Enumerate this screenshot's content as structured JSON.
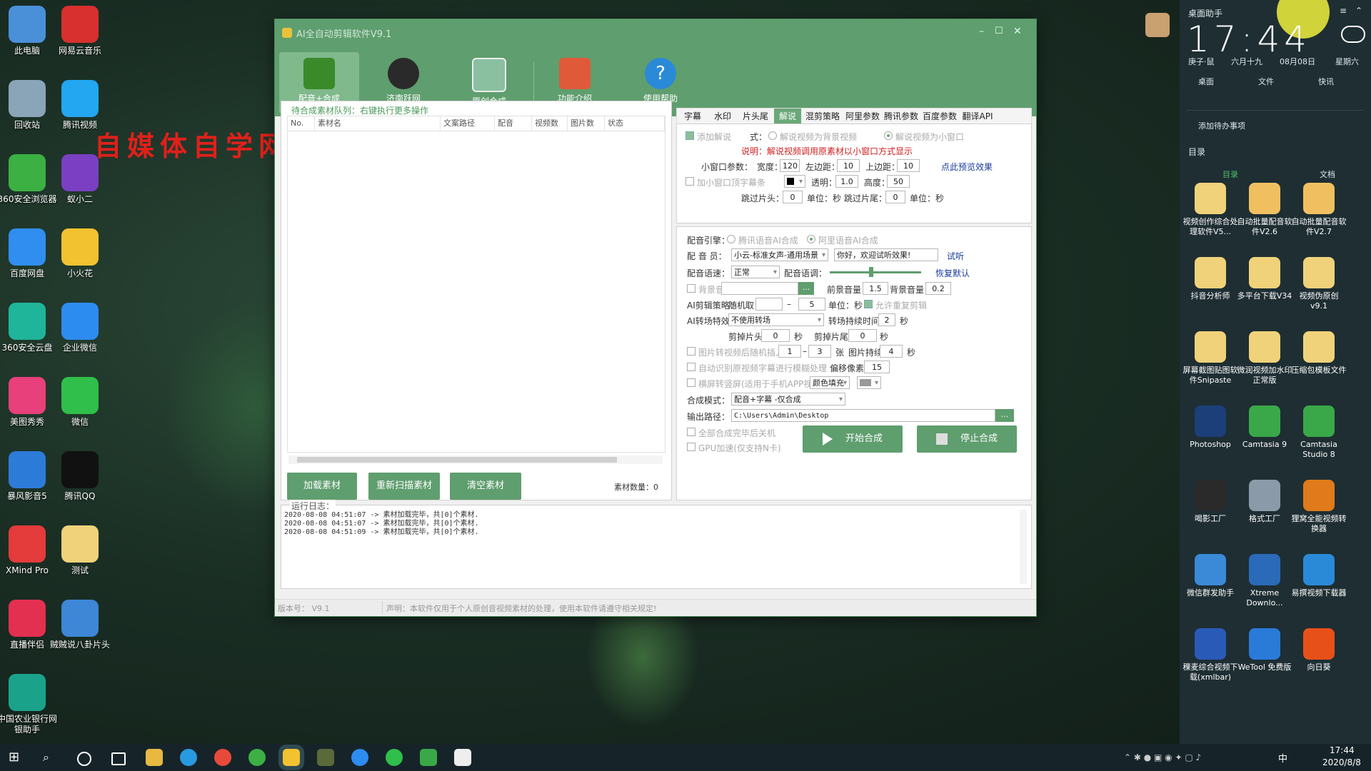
{
  "desktop": {
    "watermark": "自媒体自学网",
    "icons_left": [
      {
        "label": "此电脑",
        "color": "#4a90d9"
      },
      {
        "label": "回收站",
        "color": "#8aa4b8"
      },
      {
        "label": "360安全浏览器",
        "color": "#3cb043"
      },
      {
        "label": "百度网盘",
        "color": "#2f8ef0"
      },
      {
        "label": "360安全云盘",
        "color": "#1fb59a"
      },
      {
        "label": "美图秀秀",
        "color": "#e8407a"
      },
      {
        "label": "暴风影音5",
        "color": "#2d7bd8"
      },
      {
        "label": "XMind Pro",
        "color": "#e43b3b"
      },
      {
        "label": "直播伴侣",
        "color": "#e33050"
      },
      {
        "label": "中国农业银行网银助手",
        "color": "#1aa38a"
      }
    ],
    "icons_right": [
      {
        "label": "网易云音乐",
        "color": "#d8302e"
      },
      {
        "label": "腾讯视频",
        "color": "#22a7f0"
      },
      {
        "label": "蚁小二",
        "color": "#7a3fc2"
      },
      {
        "label": "小火花",
        "color": "#f2c230"
      },
      {
        "label": "企业微信",
        "color": "#2d8cf0"
      },
      {
        "label": "微信",
        "color": "#2fbf4a"
      },
      {
        "label": "腾讯QQ",
        "color": "#111111"
      },
      {
        "label": "测试",
        "color": "#f0d27a"
      },
      {
        "label": "贼贼说八卦片头",
        "color": "#3d87d6"
      }
    ]
  },
  "window": {
    "title": "AI全自动剪辑软件V9.1",
    "controls": [
      "–",
      "☐",
      "✕"
    ],
    "toolbar": [
      {
        "label": "配音+合成",
        "icon": "clapper-icon",
        "active": true
      },
      {
        "label": "济南跃网",
        "icon": "film-reel-icon",
        "active": false
      },
      {
        "label": "原创合成",
        "icon": "image-edit-icon",
        "active": false
      },
      {
        "label": "功能介绍",
        "icon": "home-icon",
        "active": false
      },
      {
        "label": "使用帮助",
        "icon": "help-icon",
        "active": false
      }
    ],
    "queue": {
      "title": "待合成素材队列：右键执行更多操作",
      "columns": [
        "No.",
        "素材名",
        "文案路径",
        "配音",
        "视频数",
        "图片数",
        "状态"
      ],
      "buttons": [
        "加载素材",
        "重新扫描素材",
        "清空素材"
      ],
      "count_label": "素材数量：",
      "count": "0"
    },
    "tabs": [
      "字幕",
      "水印",
      "片头尾",
      "解说",
      "混剪策略",
      "阿里参数",
      "腾讯参数",
      "百度参数",
      "翻译API"
    ],
    "active_tab": "解说",
    "narration": {
      "add_label": "添加解说",
      "mode_label": "式：",
      "mode_bg": "解说视频为背景视频",
      "mode_small": "解说视频为小窗口",
      "note": "说明：解说视频调用原素材以小窗口方式显示",
      "small_params": "小窗口参数：",
      "width_label": "宽度：",
      "width": "120",
      "left_label": "左边距：",
      "left": "10",
      "top_label": "上边距：",
      "top": "10",
      "preview": "点此预览效果",
      "top_sub_label": "加小窗口顶字幕条",
      "alpha_label": "透明：",
      "alpha": "1.0",
      "height_label": "高度：",
      "height": "50",
      "skip_head_label": "跳过片头：",
      "skip_head": "0",
      "unit_sec": "单位：秒",
      "skip_tail_label": "跳过片尾：",
      "skip_tail": "0"
    },
    "voice": {
      "engine_label": "配音引擎：",
      "engine_tencent": "腾讯语音AI合成",
      "engine_ali": "阿里语音AI合成",
      "actor_label": "配 音 员：",
      "actor": "小云-标准女声-通用场景",
      "sample_text": "你好，欢迎试听效果!",
      "try": "试听",
      "speed_label": "配音语速：",
      "speed": "正常",
      "tone_label": "配音语调：",
      "tone_level": 0.45,
      "reset": "恢复默认",
      "bgm_label": "背景音",
      "browse": "...",
      "fg_vol_label": "前景音量：",
      "fg_vol": "1.5",
      "bg_vol_label": "背景音量：",
      "bg_vol": "0.2",
      "cut_label": "AI剪辑策略：",
      "random_label": "随机取：",
      "random_from": "",
      "dash": "–",
      "random_to": "5",
      "unit_sec": "单位：秒",
      "allow_repeat": "允许重复剪辑",
      "transition_label": "AI转场特效：",
      "transition": "不使用转场",
      "trans_dur_label": "转场持续时间：",
      "trans_dur": "2",
      "sec": "秒",
      "cut_head_label": "剪掉片头：",
      "cut_head": "0",
      "cut_tail_label": "剪掉片尾：",
      "cut_tail": "0",
      "img_insert": "图片转视频后随机插入",
      "img_from": "1",
      "img_to": "3",
      "zhang": "张",
      "img_dur_label": "图片持续：",
      "img_dur": "4",
      "blur_sub": "自动识别原视频字幕进行模糊处理",
      "offset_label": "偏移像素：",
      "offset": "15",
      "portrait": "横屏转竖屏(适用于手机APP视频)",
      "fill": "颜色填充",
      "compose_label": "合成模式：",
      "compose": "配音+字幕 -仅合成",
      "output_label": "输出路径：",
      "output": "C:\\Users\\Admin\\Desktop",
      "shutdown": "全部合成完毕后关机",
      "gpu": "GPU加速(仅支持N卡)",
      "start": "开始合成",
      "stop": "停止合成"
    },
    "log": {
      "title": "运行日志：",
      "lines": [
        "2020-08-08 04:51:07 -> 素材加载完毕，共[0]个素材.",
        "2020-08-08 04:51:07 -> 素材加载完毕，共[0]个素材.",
        "2020-08-08 04:51:09 -> 素材加载完毕，共[0]个素材."
      ]
    },
    "status": {
      "version": "版本号： V9.1",
      "notice": "声明：本软件仅用于个人原创音视频素材的处理，使用本软件请遵守相关规定!"
    }
  },
  "side_panel": {
    "title": "桌面助手",
    "time": "17:44",
    "lunar1": "庚子·鼠",
    "lunar2": "六月十九",
    "date": "08月08日",
    "weekday": "星期六",
    "tabs": [
      "桌面",
      "文件",
      "快讯"
    ],
    "todo": "添加待办事项",
    "dir_label": "目录",
    "col1": "目录",
    "col2": "文档",
    "apps": [
      {
        "label": "视频创作综合处理软件V5...",
        "color": "#f0d27a"
      },
      {
        "label": "自动批量配音软件V2.6",
        "color": "#f0c060"
      },
      {
        "label": "自动批量配音软件V2.7",
        "color": "#f0c060"
      },
      {
        "label": "抖音分析师",
        "color": "#f0d27a"
      },
      {
        "label": "多平台下载V34",
        "color": "#f0d27a"
      },
      {
        "label": "视频伪原创v9.1",
        "color": "#f0d27a"
      },
      {
        "label": "屏幕截图贴图软件Snipaste",
        "color": "#f0d27a"
      },
      {
        "label": "微润视频加水印正常版",
        "color": "#f0d27a"
      },
      {
        "label": "压缩包模板文件",
        "color": "#f0d27a"
      },
      {
        "label": "Photoshop",
        "color": "#1c3f7a"
      },
      {
        "label": "Camtasia 9",
        "color": "#3aa848"
      },
      {
        "label": "Camtasia Studio 8",
        "color": "#3aa848"
      },
      {
        "label": "喝影工厂",
        "color": "#2a2a2a"
      },
      {
        "label": "格式工厂",
        "color": "#8a9aa8"
      },
      {
        "label": "狸窝全能视频转换器",
        "color": "#e07a1a"
      },
      {
        "label": "微信群发助手",
        "color": "#3a8ad8"
      },
      {
        "label": "Xtreme Downlo...",
        "color": "#2a6ab8"
      },
      {
        "label": "易撰视频下载器",
        "color": "#2a8ad8"
      },
      {
        "label": "稞麦综合视频下载(xmlbar)",
        "color": "#2a5ab8"
      },
      {
        "label": "WeTool 免费版",
        "color": "#2a7ad8"
      },
      {
        "label": "向日葵",
        "color": "#e8501a"
      }
    ]
  },
  "taskbar": {
    "time": "17:44",
    "date": "2020/8/8",
    "ime": "中"
  }
}
